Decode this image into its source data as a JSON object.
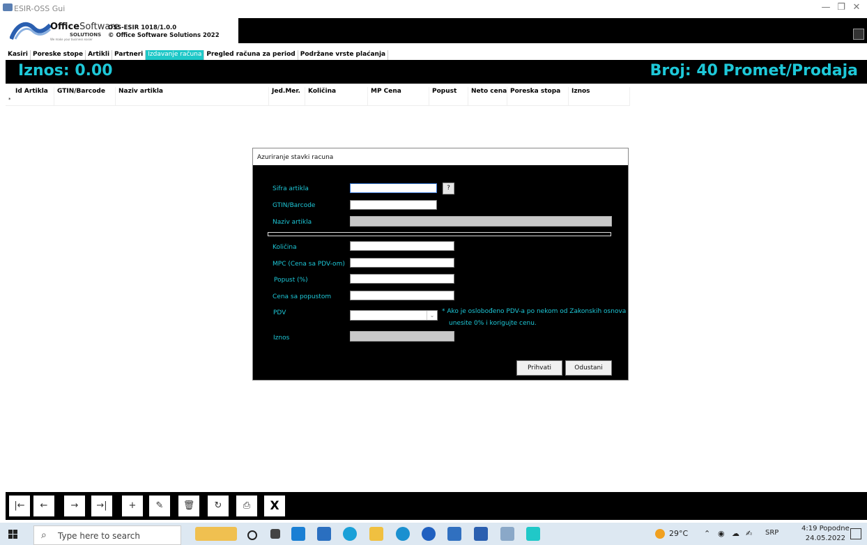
{
  "window": {
    "title": "ESIR-OSS Gui",
    "controls": {
      "minimize": "—",
      "maximize": "❐",
      "close": "✕"
    }
  },
  "header": {
    "brand_bold": "Office",
    "brand_light": "Software",
    "brand_sub": "SOLUTIONS",
    "brand_tagline": "We make your business easier",
    "version": "OSS-ESIR 1018/1.0.0",
    "copyright": "© Office Software Solutions 2022"
  },
  "menu": {
    "tabs": [
      {
        "label": "Kasiri",
        "active": false
      },
      {
        "label": "Poreske stope",
        "active": false
      },
      {
        "label": "Artikli",
        "active": false
      },
      {
        "label": "Partneri",
        "active": false
      },
      {
        "label": "Izdavanje računa",
        "active": true
      },
      {
        "label": "Pregled računa za period",
        "active": false
      },
      {
        "label": "Podržane vrste plaćanja",
        "active": false
      }
    ]
  },
  "banner": {
    "iznos": "Iznos: 0.00",
    "broj": "Broj: 40",
    "promet": "Promet/Prodaja"
  },
  "grid": {
    "columns": [
      "Id Artikla",
      "GTIN/Barcode",
      "Naziv artikla",
      "Jed.Mer.",
      "Količina",
      "MP Cena",
      "Popust",
      "Neto cena",
      "Poreska stopa",
      "Iznos"
    ],
    "new_row_marker": "*"
  },
  "dialog": {
    "title": "Azuriranje stavki racuna",
    "fields": {
      "sifra": {
        "label": "Sifra artikla",
        "value": "",
        "lookup_button": "?"
      },
      "gtin": {
        "label": "GTIN/Barcode",
        "value": ""
      },
      "naziv": {
        "label": "Naziv artikla",
        "value": ""
      },
      "kolicina": {
        "label": "Količina",
        "value": ""
      },
      "mpc": {
        "label": "MPC (Cena sa PDV-om)",
        "value": ""
      },
      "popust": {
        "label": "Popust (%)",
        "value": ""
      },
      "cena_popust": {
        "label": "Cena sa popustom",
        "value": ""
      },
      "pdv": {
        "label": "PDV",
        "value": ""
      },
      "iznos": {
        "label": "Iznos",
        "value": ""
      }
    },
    "pdv_note_line1": "* Ako je oslobođeno PDV-a po nekom od Zakonskih osnova",
    "pdv_note_line2": "unesite 0% i korigujte cenu.",
    "buttons": {
      "accept": "Prihvati",
      "cancel": "Odustani"
    }
  },
  "toolbar": {
    "buttons": [
      {
        "name": "first-record-button",
        "glyph": "|←"
      },
      {
        "name": "previous-record-button",
        "glyph": "←"
      },
      {
        "name": "next-record-button",
        "glyph": "→"
      },
      {
        "name": "last-record-button",
        "glyph": "→|"
      },
      {
        "name": "add-record-button",
        "glyph": "+"
      },
      {
        "name": "edit-record-button",
        "glyph": "✎"
      },
      {
        "name": "delete-record-button",
        "glyph": "🗑"
      },
      {
        "name": "refresh-button",
        "glyph": "↻"
      },
      {
        "name": "print-button",
        "glyph": "⎙"
      },
      {
        "name": "close-button",
        "glyph": "X"
      }
    ]
  },
  "taskbar": {
    "search_placeholder": "Type here to search",
    "temperature": "29°C",
    "language": "SRP",
    "time": "4:19 Popodne",
    "date": "24.05.2022"
  },
  "colors": {
    "accent": "#1ec8d8",
    "background_dark": "#000000"
  }
}
